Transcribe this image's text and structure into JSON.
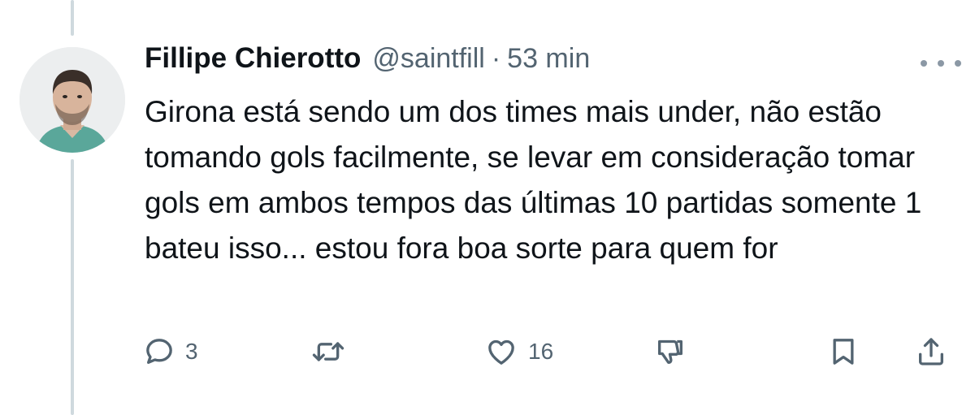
{
  "tweet": {
    "author_name": "Fillipe Chierotto",
    "handle": "@saintfill",
    "separator": "·",
    "time": "53 min",
    "text": "Girona está sendo um dos times mais under, não estão tomando gols facilmente, se levar em consideração tomar gols em ambos tempos das últimas 10 partidas somente 1 bateu isso... estou fora boa sorte para quem for"
  },
  "actions": {
    "reply_count": "3",
    "retweet_count": "",
    "like_count": "16"
  },
  "icons": {
    "more": "more-dots-icon",
    "reply": "reply-bubble-icon",
    "retweet": "retweet-arrows-icon",
    "like": "heart-icon",
    "dislike": "thumbs-down-icon",
    "bookmark": "bookmark-icon",
    "share": "share-upload-icon"
  },
  "colors": {
    "text": "#0f1419",
    "secondary": "#536471",
    "thread_line": "#cfd9de"
  }
}
